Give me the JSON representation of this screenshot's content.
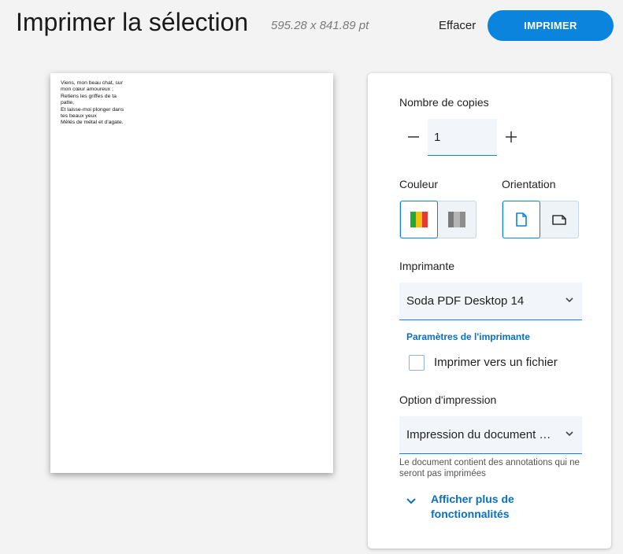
{
  "header": {
    "title": "Imprimer la sélection",
    "dimensions": "595.28 x 841.89 pt",
    "clear_label": "Effacer",
    "print_label": "IMPRIMER"
  },
  "preview": {
    "lines": [
      "Viens, mon beau chat, sur",
      "mon cœur amoureux ;",
      "Retiens les griffes de ta",
      "patte,",
      "Et laisse-moi plonger dans",
      "tes beaux yeux",
      "Mêlés de métal et d'agate."
    ]
  },
  "panel": {
    "copies_label": "Nombre de copies",
    "copies_value": "1",
    "color_label": "Couleur",
    "orientation_label": "Orientation",
    "color_options": [
      "color-icon",
      "grayscale-icon"
    ],
    "color_selected": "color",
    "orientation_options": [
      "portrait-icon",
      "landscape-icon"
    ],
    "orientation_selected": "portrait",
    "printer_label": "Imprimante",
    "printer_value": "Soda PDF Desktop 14",
    "printer_settings_link": "Paramètres de l'imprimante",
    "print_to_file_label": "Imprimer vers un fichier",
    "print_to_file_checked": false,
    "print_option_label": "Option d'impression",
    "print_option_value": "Impression du document et annotations",
    "annotation_note": "Le document contient des annotations qui ne seront pas imprimées",
    "more_features_label": "Afficher plus de fonctionnalités"
  },
  "colors": {
    "accent": "#0a84dc",
    "background": "#f3f3f3",
    "link": "#0a6fc2"
  }
}
